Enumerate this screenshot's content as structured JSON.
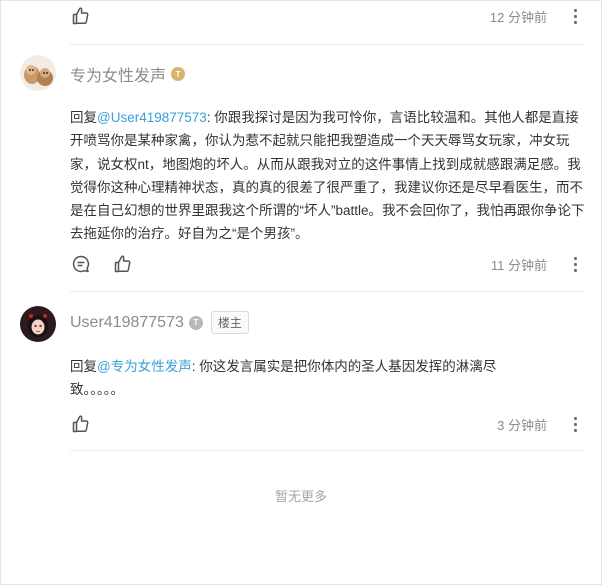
{
  "colors": {
    "mention": "#3aa0d8",
    "time": "#8a8a8a",
    "username": "#8c8c8c",
    "badge_gold": "#d9b36a",
    "badge_gray": "#b8b8b8"
  },
  "top_row": {
    "time": "12 分钟前"
  },
  "comments": [
    {
      "username": "专为女性发声",
      "badge_icon": "level-badge-gold",
      "reply_prefix": "回复",
      "mention": "@User419877573",
      "text": ": 你跟我探讨是因为我可怜你，言语比较温和。其他人都是直接开喷骂你是某种家禽，你认为惹不起就只能把我塑造成一个天天辱骂女玩家，冲女玩家，说女权nt，地图炮的坏人。从而从跟我对立的这件事情上找到成就感跟满足感。我觉得你这种心理精神状态，真的真的很差了很严重了，我建议你还是尽早看医生，而不是在自己幻想的世界里跟我这个所谓的“坏人”battle。我不会回你了，我怕再跟你争论下去拖延你的治疗。好自为之“是个男孩”。",
      "time": "11 分钟前"
    },
    {
      "username": "User419877573",
      "badge_icon": "level-badge-gray",
      "owner_tag": "楼主",
      "reply_prefix": "回复",
      "mention": "@专为女性发声",
      "text": ": 你这发言属实是把你体内的圣人基因发挥的淋漓尽致。。。。。",
      "time": "3 分钟前"
    }
  ],
  "footer": {
    "no_more": "暂无更多"
  }
}
